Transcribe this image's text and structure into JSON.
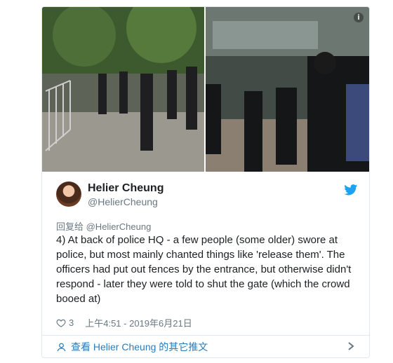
{
  "tweet": {
    "author_name": "Helier Cheung",
    "author_handle": "@HelierCheung",
    "reply_to": "回复给 @HelierCheung",
    "text": "4) At back of police HQ - a few people (some older) swore at police, but most mainly chanted things like 'release them'. The officers had put out fences by the entrance, but otherwise didn't respond - later they were told to shut the gate (which the crowd booed at)",
    "likes": "3",
    "timestamp": "上午4:51 - 2019年6月21日",
    "info_glyph": "i"
  },
  "footer": {
    "view_more_label": "查看 Helier Cheung 的其它推文"
  },
  "colors": {
    "link": "#2b7bb9",
    "twitter_blue": "#1da1f2",
    "muted": "#697882",
    "border": "#e1e8ed"
  },
  "icons": {
    "info": "info-icon",
    "bird": "twitter-bird-icon",
    "heart": "heart-icon",
    "profile": "profile-icon",
    "chevron": "chevron-right-icon"
  }
}
